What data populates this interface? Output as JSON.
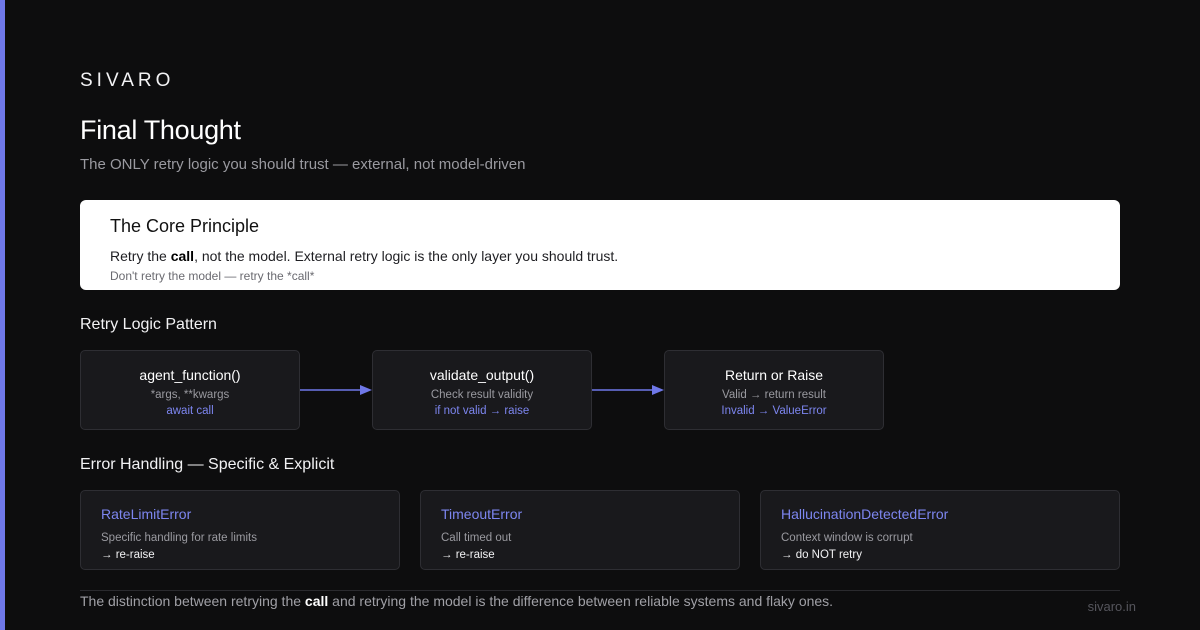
{
  "brand": "SIVARO",
  "title": "Final Thought",
  "subtitle": "The ONLY retry logic you should trust — external, not model-driven",
  "principle": {
    "title": "The Core Principle",
    "body_before": "Retry the ",
    "body_bold": "call",
    "body_after": ", not the model. External retry logic is the only layer you should trust.",
    "note": "Don't retry the model — retry the *call*"
  },
  "retry_section": {
    "label": "Retry Logic Pattern",
    "steps": [
      {
        "name": "agent_function()",
        "sub": "*args, **kwargs",
        "action": "await call"
      },
      {
        "name": "validate_output()",
        "sub": "Check result validity",
        "action": "if not valid → raise"
      },
      {
        "name": "Return or Raise",
        "sub": "Valid → return result",
        "action": "Invalid → ValueError"
      }
    ]
  },
  "error_section": {
    "label": "Error Handling — Specific & Explicit",
    "errors": [
      {
        "name": "RateLimitError",
        "desc": "Specific handling for rate limits",
        "action": "→ re-raise"
      },
      {
        "name": "TimeoutError",
        "desc": "Call timed out",
        "action": "→ re-raise"
      },
      {
        "name": "HallucinationDetectedError",
        "desc": "Context window is corrupt",
        "action": "→ do NOT retry"
      }
    ]
  },
  "footer": {
    "before": "The distinction between retrying the ",
    "bold": "call",
    "after": " and retrying the model is the difference between reliable systems and flaky ones."
  },
  "site": "sivaro.in",
  "colors": {
    "accent": "#6f78e8",
    "link": "#7d86f0",
    "background": "#0d0d0e",
    "card": "#19191c"
  }
}
